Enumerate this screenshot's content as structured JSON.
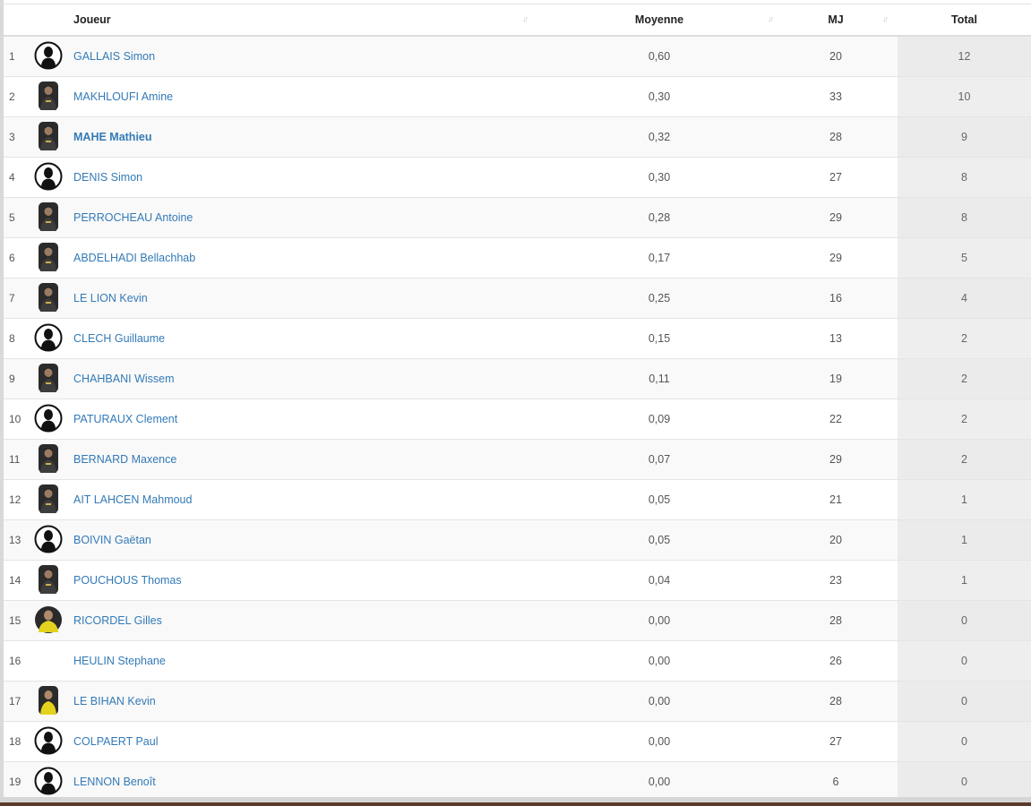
{
  "table": {
    "headers": {
      "player": "Joueur",
      "average": "Moyenne",
      "matches": "MJ",
      "total": "Total"
    },
    "sort_icon": "sort-arrows-icon",
    "colors": {
      "link": "#337ab7",
      "row_stripe": "#f9f9f9",
      "total_column": "#eeeeee"
    },
    "rows": [
      {
        "rank": "1",
        "name": "GALLAIS Simon",
        "average": "0,60",
        "matches": "20",
        "total": "12",
        "avatar": "placeholder-silhouette",
        "bold": false
      },
      {
        "rank": "2",
        "name": "MAKHLOUFI Amine",
        "average": "0,30",
        "matches": "33",
        "total": "10",
        "avatar": "player-photo-dark",
        "bold": false
      },
      {
        "rank": "3",
        "name": "MAHE Mathieu",
        "average": "0,32",
        "matches": "28",
        "total": "9",
        "avatar": "player-photo-dark",
        "bold": true
      },
      {
        "rank": "4",
        "name": "DENIS Simon",
        "average": "0,30",
        "matches": "27",
        "total": "8",
        "avatar": "placeholder-silhouette",
        "bold": false
      },
      {
        "rank": "5",
        "name": "PERROCHEAU Antoine",
        "average": "0,28",
        "matches": "29",
        "total": "8",
        "avatar": "player-photo-dark",
        "bold": false
      },
      {
        "rank": "6",
        "name": "ABDELHADI Bellachhab",
        "average": "0,17",
        "matches": "29",
        "total": "5",
        "avatar": "player-photo-dark",
        "bold": false
      },
      {
        "rank": "7",
        "name": "LE LION Kevin",
        "average": "0,25",
        "matches": "16",
        "total": "4",
        "avatar": "player-photo-dark",
        "bold": false
      },
      {
        "rank": "8",
        "name": "CLECH Guillaume",
        "average": "0,15",
        "matches": "13",
        "total": "2",
        "avatar": "placeholder-silhouette",
        "bold": false
      },
      {
        "rank": "9",
        "name": "CHAHBANI Wissem",
        "average": "0,11",
        "matches": "19",
        "total": "2",
        "avatar": "player-photo-dark",
        "bold": false
      },
      {
        "rank": "10",
        "name": "PATURAUX Clement",
        "average": "0,09",
        "matches": "22",
        "total": "2",
        "avatar": "placeholder-silhouette",
        "bold": false
      },
      {
        "rank": "11",
        "name": "BERNARD Maxence",
        "average": "0,07",
        "matches": "29",
        "total": "2",
        "avatar": "player-photo-dark",
        "bold": false
      },
      {
        "rank": "12",
        "name": "AIT LAHCEN Mahmoud",
        "average": "0,05",
        "matches": "21",
        "total": "1",
        "avatar": "player-photo-dark",
        "bold": false
      },
      {
        "rank": "13",
        "name": "BOIVIN Gaëtan",
        "average": "0,05",
        "matches": "20",
        "total": "1",
        "avatar": "placeholder-silhouette",
        "bold": false
      },
      {
        "rank": "14",
        "name": "POUCHOUS Thomas",
        "average": "0,04",
        "matches": "23",
        "total": "1",
        "avatar": "player-photo-dark",
        "bold": false
      },
      {
        "rank": "15",
        "name": "RICORDEL Gilles",
        "average": "0,00",
        "matches": "28",
        "total": "0",
        "avatar": "player-photo-yellow-round",
        "bold": false
      },
      {
        "rank": "16",
        "name": "HEULIN Stephane",
        "average": "0,00",
        "matches": "26",
        "total": "0",
        "avatar": "blank",
        "bold": false
      },
      {
        "rank": "17",
        "name": "LE BIHAN Kevin",
        "average": "0,00",
        "matches": "28",
        "total": "0",
        "avatar": "player-photo-yellow",
        "bold": false
      },
      {
        "rank": "18",
        "name": "COLPAERT Paul",
        "average": "0,00",
        "matches": "27",
        "total": "0",
        "avatar": "placeholder-silhouette",
        "bold": false
      },
      {
        "rank": "19",
        "name": "LENNON Benoît",
        "average": "0,00",
        "matches": "6",
        "total": "0",
        "avatar": "placeholder-silhouette",
        "bold": false
      }
    ]
  }
}
